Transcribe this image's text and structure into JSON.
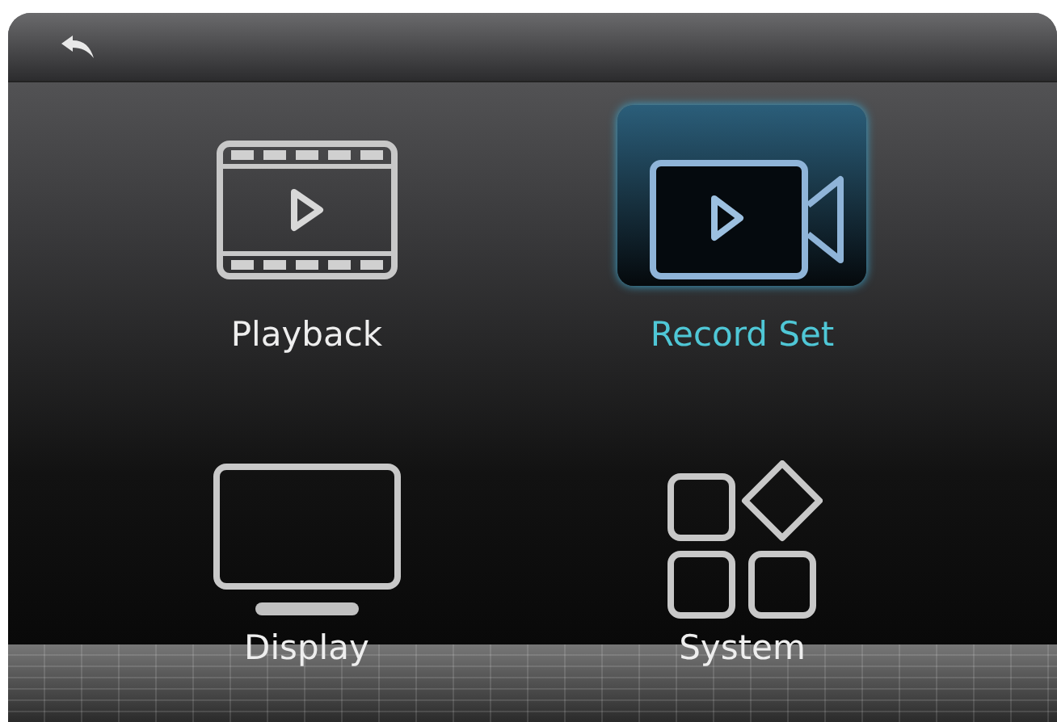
{
  "header": {
    "back": true
  },
  "menu": [
    {
      "kind": "film",
      "label": "Playback",
      "selected": false
    },
    {
      "kind": "camera",
      "label": "Record Set",
      "selected": true
    },
    {
      "kind": "monitor",
      "label": "Display",
      "selected": false
    },
    {
      "kind": "apps",
      "label": "System",
      "selected": false
    }
  ]
}
